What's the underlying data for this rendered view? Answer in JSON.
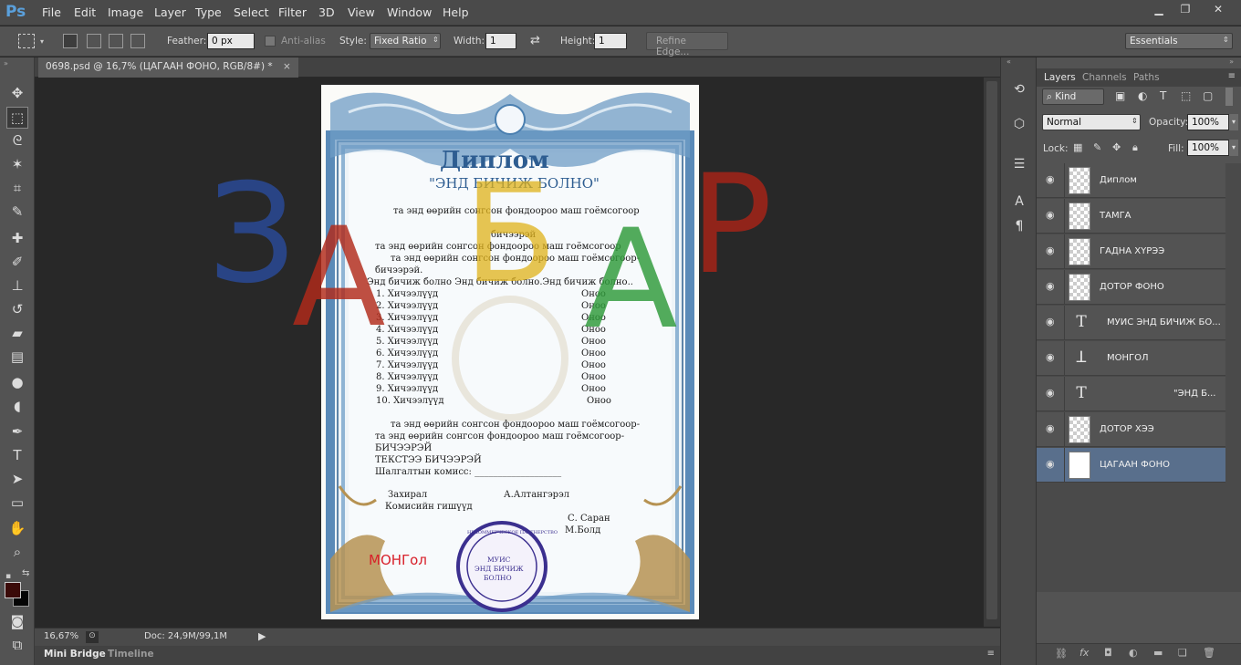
{
  "app": {
    "logo": "Ps"
  },
  "menu": [
    "File",
    "Edit",
    "Image",
    "Layer",
    "Type",
    "Select",
    "Filter",
    "3D",
    "View",
    "Window",
    "Help"
  ],
  "window_controls": {
    "minimize": "minimize-icon",
    "restore": "restore-icon",
    "close": "close-icon"
  },
  "options": {
    "feather_label": "Feather:",
    "feather_value": "0 px",
    "antialias_label": "Anti-alias",
    "style_label": "Style:",
    "style_value": "Fixed Ratio",
    "width_label": "Width:",
    "width_value": "1",
    "height_label": "Height:",
    "height_value": "1",
    "refine_edge": "Refine Edge...",
    "workspace": "Essentials"
  },
  "document": {
    "tab_title": "0698.psd @ 16,7% (ЦАГААН ФОНО, RGB/8#) *",
    "zoom": "16,67%",
    "doc_size": "Doc: 24,9M/99,1M"
  },
  "bottom_tabs": [
    "Mini Bridge",
    "Timeline"
  ],
  "panels": {
    "tabs": [
      "Layers",
      "Channels",
      "Paths"
    ],
    "filter_kind": "Kind",
    "blend_mode": "Normal",
    "opacity_label": "Opacity:",
    "opacity_value": "100%",
    "lock_label": "Lock:",
    "fill_label": "Fill:",
    "fill_value": "100%"
  },
  "layers": [
    {
      "name": "Диплом",
      "kind": "pixel",
      "selected": false
    },
    {
      "name": "ТАМГА",
      "kind": "pixel",
      "selected": false
    },
    {
      "name": "ГАДНА ХҮРЭЭ",
      "kind": "pixel",
      "selected": false
    },
    {
      "name": "ДОТОР ФОНО",
      "kind": "pixel",
      "selected": false
    },
    {
      "name": "МУИС ЭНД БИЧИЖ БО...",
      "kind": "text",
      "selected": false
    },
    {
      "name": "МОНГОЛ",
      "kind": "warped-text",
      "selected": false
    },
    {
      "name": "\"ЭНД Б...",
      "kind": "text",
      "selected": false
    },
    {
      "name": "ДОТОР ХЭЭ",
      "kind": "pixel",
      "selected": false
    },
    {
      "name": "ЦАГААН ФОНО",
      "kind": "solid",
      "selected": true
    }
  ],
  "canvas": {
    "watermark": [
      "З",
      "А",
      "Б",
      "А",
      "Р"
    ],
    "watermark_colors": [
      "#2a4b9a",
      "#b22a1a",
      "#e0b21a",
      "#2f9a3a",
      "#a82418"
    ],
    "diploma": {
      "title": "Диплом",
      "subtitle": "\"ЭНД БИЧИЖ БОЛНО\"",
      "intro_line": "та энд өөрийн сонгсон фондоороо маш гоёмсогоор",
      "line_b1": "бичээрэй",
      "line_b2": "та энд өөрийн сонгсон фондоороо маш гоёмсогоор",
      "line_b3": "та энд өөрийн сонгсон фондоороо маш гоёмсогоор-",
      "line_b4": "бичээрэй.",
      "line_b5": "Энд бичиж болно Энд бичиж болно.Энд бичиж болно..",
      "subjects": [
        {
          "label": "1. Хичээлүүд",
          "value": "Оноо"
        },
        {
          "label": "2. Хичээлүүд",
          "value": "Оноо"
        },
        {
          "label": "3. Хичээлүүд",
          "value": "Оноо"
        },
        {
          "label": "4. Хичээлүүд",
          "value": "Оноо"
        },
        {
          "label": "5. Хичээлүүд",
          "value": "Оноо"
        },
        {
          "label": "6. Хичээлүүд",
          "value": "Оноо"
        },
        {
          "label": "7. Хичээлүүд",
          "value": "Оноо"
        },
        {
          "label": "8. Хичээлүүд",
          "value": "Оноо"
        },
        {
          "label": "9. Хичээлүүд",
          "value": "Оноо"
        },
        {
          "label": "10. Хичээлүүд",
          "value": "Оноо"
        }
      ],
      "line_c1": "та энд өөрийн сонгсон фондоороо маш гоёмсогоор-",
      "line_c2": "та энд өөрийн сонгсон фондоороо маш гоёмсогоор-",
      "line_c3": "БИЧЭЭРЭЙ",
      "line_c4": "ТЕКСТЭЭ БИЧЭЭРЭЙ",
      "examiner": "Шалгалтын комисс: ___________________",
      "director_label": "Захирал",
      "director_name": "А.Алтангэрэл",
      "commission_label": "Комисийн гишүүд",
      "member1": "С. Саран",
      "member2": "М.Болд",
      "mongol_text": "МОНГол",
      "stamp_line1": "МУИС",
      "stamp_line2": "ЭНД БИЧИЖ",
      "stamp_line3": "БОЛНО",
      "stamp_ring": "НЕКОММЕРЧЕСКОЕ ПАРТНЕРСТВО"
    }
  },
  "colors": {
    "accent_selected_layer": "#596f8c",
    "frame_blue": "#4a7fb0",
    "mongol_red": "#d8202a",
    "stamp_purple": "#3b2f8f"
  }
}
